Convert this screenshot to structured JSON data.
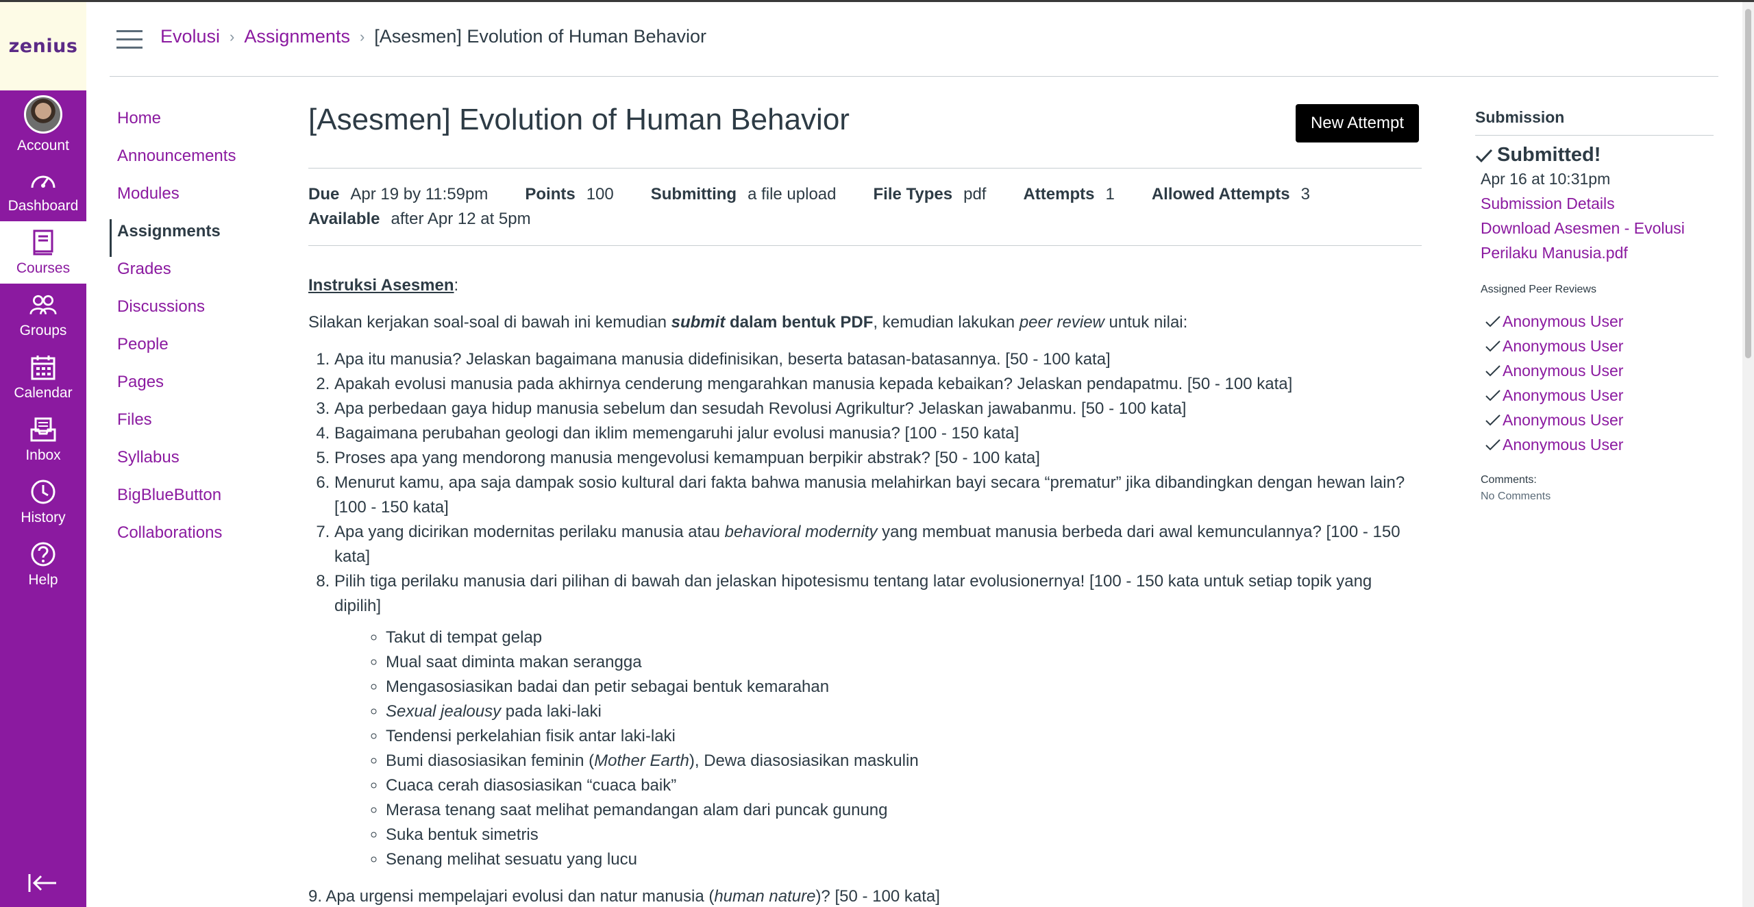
{
  "global_nav": {
    "logo": "zenius",
    "items": [
      {
        "label": "Account",
        "icon": "avatar"
      },
      {
        "label": "Dashboard",
        "icon": "dashboard-icon"
      },
      {
        "label": "Courses",
        "icon": "courses-icon"
      },
      {
        "label": "Groups",
        "icon": "groups-icon"
      },
      {
        "label": "Calendar",
        "icon": "calendar-icon"
      },
      {
        "label": "Inbox",
        "icon": "inbox-icon"
      },
      {
        "label": "History",
        "icon": "history-icon"
      },
      {
        "label": "Help",
        "icon": "help-icon"
      }
    ],
    "colors": {
      "nav_bg": "#8b1aa0",
      "logo_bg": "#fdfbe6",
      "accent": "#8b1aa0"
    }
  },
  "breadcrumb": {
    "course": "Evolusi",
    "section": "Assignments",
    "current": "[Asesmen] Evolution of Human Behavior"
  },
  "course_nav": [
    "Home",
    "Announcements",
    "Modules",
    "Assignments",
    "Grades",
    "Discussions",
    "People",
    "Pages",
    "Files",
    "Syllabus",
    "BigBlueButton",
    "Collaborations"
  ],
  "assignment": {
    "title": "[Asesmen] Evolution of Human Behavior",
    "new_attempt_label": "New Attempt",
    "details": {
      "due_label": "Due",
      "due": "Apr 19 by 11:59pm",
      "points_label": "Points",
      "points": "100",
      "submitting_label": "Submitting",
      "submitting": "a file upload",
      "file_types_label": "File Types",
      "file_types": "pdf",
      "attempts_label": "Attempts",
      "attempts": "1",
      "allowed_label": "Allowed Attempts",
      "allowed": "3",
      "available_label": "Available",
      "available": "after Apr 12 at 5pm"
    },
    "instructions_heading": "Instruksi Asesmen",
    "intro": {
      "a": "Silakan kerjakan soal-soal di bawah ini kemudian ",
      "b": "submit",
      "c": " dalam bentuk PDF",
      "d": ", kemudian lakukan ",
      "e": "peer review",
      "f": " untuk nilai:"
    },
    "questions": [
      "Apa itu manusia? Jelaskan bagaimana manusia didefinisikan, beserta batasan-batasannya. [50 - 100 kata]",
      "Apakah evolusi manusia pada akhirnya cenderung mengarahkan manusia kepada kebaikan? Jelaskan pendapatmu. [50 - 100 kata]",
      "Apa perbedaan gaya hidup manusia sebelum dan sesudah Revolusi Agrikultur? Jelaskan jawabanmu. [50 - 100 kata]",
      "Bagaimana perubahan geologi dan iklim memengaruhi jalur evolusi manusia? [100 - 150 kata]",
      "Proses apa yang mendorong manusia mengevolusi kemampuan berpikir abstrak? [50 - 100 kata]",
      "Menurut kamu, apa saja dampak sosio kultural dari fakta bahwa manusia melahirkan bayi secara “prematur” jika dibandingkan dengan hewan lain? [100 - 150 kata]"
    ],
    "q7": {
      "a": "Apa yang dicirikan modernitas perilaku manusia atau ",
      "b": "behavioral modernity",
      "c": " yang membuat manusia berbeda dari awal kemunculannya? [100 - 150 kata]"
    },
    "q8": "Pilih tiga perilaku manusia dari pilihan di bawah dan jelaskan hipotesismu tentang latar evolusionernya! [100 - 150 kata untuk setiap topik yang dipilih]",
    "options": {
      "o1": "Takut di tempat gelap",
      "o2": "Mual saat diminta makan serangga",
      "o3": "Mengasosiasikan badai dan petir sebagai bentuk kemarahan",
      "o4a": "Sexual jealousy",
      "o4b": " pada laki-laki",
      "o5": "Tendensi perkelahian fisik antar laki-laki",
      "o6a": "Bumi diasosiasikan feminin (",
      "o6b": "Mother Earth",
      "o6c": "), Dewa diasosiasikan maskulin",
      "o7": "Cuaca cerah diasosiasikan “cuaca baik”",
      "o8": "Merasa tenang saat melihat pemandangan alam dari puncak gunung",
      "o9": "Suka bentuk simetris",
      "o10": "Senang melihat sesuatu yang lucu"
    },
    "q9": {
      "a": "9. Apa urgensi mempelajari evolusi dan natur manusia (",
      "b": "human nature",
      "c": ")? [50 - 100 kata]"
    }
  },
  "submission": {
    "title": "Submission",
    "status": "Submitted!",
    "date": "Apr 16 at 10:31pm",
    "details_link": "Submission Details",
    "download_link": "Download Asesmen - Evolusi Perilaku Manusia.pdf",
    "peer_heading": "Assigned Peer Reviews",
    "peer_reviews": [
      "Anonymous User",
      "Anonymous User",
      "Anonymous User",
      "Anonymous User",
      "Anonymous User",
      "Anonymous User"
    ],
    "comments_label": "Comments:",
    "comments_value": "No Comments"
  }
}
